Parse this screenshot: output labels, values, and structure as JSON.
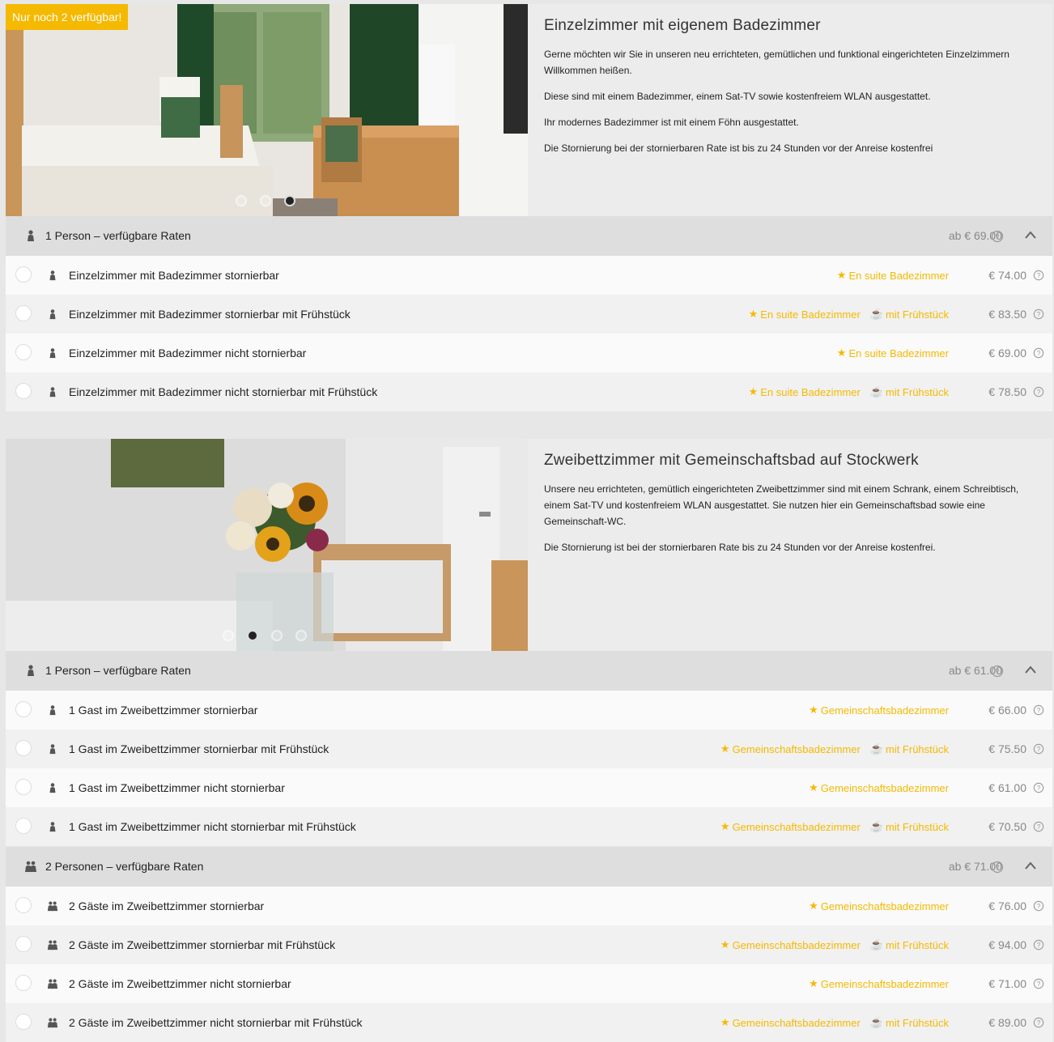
{
  "rooms": [
    {
      "badge": "Nur noch 2 verfügbar!",
      "title": "Einzelzimmer mit eigenem Badezimmer",
      "paragraphs": [
        "Gerne möchten wir Sie in unseren neu errichteten, gemütlichen und funktional eingerichteten Einzelzimmern Willkommen heißen.",
        "Diese sind mit einem Badezimmer, einem Sat-TV sowie kostenfreiem WLAN ausgestattet.",
        "Ihr modernes Badezimmer ist mit einem Föhn ausgestattet.",
        "Die Stornierung bei der stornierbaren Rate ist bis zu 24 Stunden vor der Anreise kostenfrei"
      ],
      "carousel": {
        "count": 3,
        "active": 3
      },
      "groups": [
        {
          "label": "1 Person – verfügbare Raten",
          "from": "ab € 69.00",
          "icon": "single-person-icon",
          "rates": [
            {
              "name": "Einzelzimmer mit Badezimmer stornierbar",
              "tags": [
                "En suite Badezimmer"
              ],
              "price": "€ 74.00"
            },
            {
              "name": "Einzelzimmer mit Badezimmer stornierbar mit Frühstück",
              "tags": [
                "En suite Badezimmer",
                "mit Frühstück"
              ],
              "price": "€ 83.50"
            },
            {
              "name": "Einzelzimmer mit Badezimmer nicht stornierbar",
              "tags": [
                "En suite Badezimmer"
              ],
              "price": "€ 69.00"
            },
            {
              "name": "Einzelzimmer mit Badezimmer nicht stornierbar mit Frühstück",
              "tags": [
                "En suite Badezimmer",
                "mit Frühstück"
              ],
              "price": "€ 78.50"
            }
          ]
        }
      ]
    },
    {
      "badge": "",
      "title": "Zweibettzimmer mit Gemeinschaftsbad auf Stockwerk",
      "paragraphs": [
        "Unsere neu errichteten, gemütlich eingerichteten Zweibettzimmer sind mit einem Schrank, einem Schreibtisch, einem Sat-TV und kostenfreiem WLAN ausgestattet. Sie nutzen hier ein Gemeinschaftsbad sowie eine Gemeinschaft-WC.",
        "Die Stornierung ist bei der stornierbaren Rate bis zu 24 Stunden vor der Anreise kostenfrei."
      ],
      "carousel": {
        "count": 4,
        "active": 2
      },
      "groups": [
        {
          "label": "1 Person – verfügbare Raten",
          "from": "ab € 61.00",
          "icon": "single-person-icon",
          "rates": [
            {
              "name": "1 Gast im Zweibettzimmer stornierbar",
              "tags": [
                "Gemeinschaftsbadezimmer"
              ],
              "price": "€ 66.00"
            },
            {
              "name": "1 Gast im Zweibettzimmer stornierbar mit Frühstück",
              "tags": [
                "Gemeinschaftsbadezimmer",
                "mit Frühstück"
              ],
              "price": "€ 75.50"
            },
            {
              "name": "1 Gast im Zweibettzimmer nicht stornierbar",
              "tags": [
                "Gemeinschaftsbadezimmer"
              ],
              "price": "€ 61.00"
            },
            {
              "name": "1 Gast im Zweibettzimmer nicht stornierbar mit Frühstück",
              "tags": [
                "Gemeinschaftsbadezimmer",
                "mit Frühstück"
              ],
              "price": "€ 70.50"
            }
          ]
        },
        {
          "label": "2 Personen – verfügbare Raten",
          "from": "ab € 71.00",
          "icon": "two-persons-icon",
          "rates": [
            {
              "name": "2 Gäste im Zweibettzimmer stornierbar",
              "tags": [
                "Gemeinschaftsbadezimmer"
              ],
              "price": "€ 76.00"
            },
            {
              "name": "2 Gäste im Zweibettzimmer stornierbar mit Frühstück",
              "tags": [
                "Gemeinschaftsbadezimmer",
                "mit Frühstück"
              ],
              "price": "€ 94.00"
            },
            {
              "name": "2 Gäste im Zweibettzimmer nicht stornierbar",
              "tags": [
                "Gemeinschaftsbadezimmer"
              ],
              "price": "€ 71.00"
            },
            {
              "name": "2 Gäste im Zweibettzimmer nicht stornierbar mit Frühstück",
              "tags": [
                "Gemeinschaftsbadezimmer",
                "mit Frühstück"
              ],
              "price": "€ 89.00"
            }
          ]
        }
      ]
    }
  ],
  "colors": {
    "accent": "#f5b900",
    "header_bg": "#dedede",
    "price_grey": "#888888"
  }
}
